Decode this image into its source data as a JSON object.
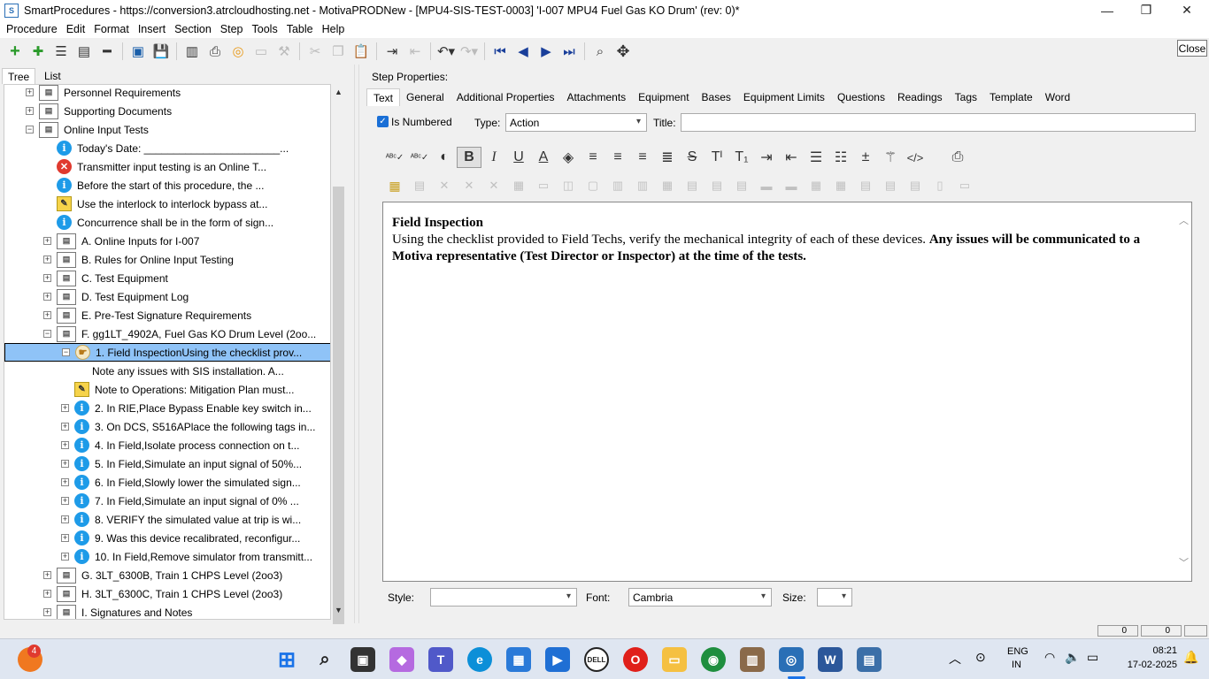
{
  "window": {
    "title": "SmartProcedures - https://conversion3.atrcloudhosting.net - MotivaPRODNew - [MPU4-SIS-TEST-0003] 'I-007 MPU4 Fuel Gas KO Drum' (rev: 0)*",
    "minimize": "—",
    "maximize": "❐",
    "close": "✕"
  },
  "menu": [
    {
      "label": "Procedure"
    },
    {
      "label": "Edit"
    },
    {
      "label": "Format"
    },
    {
      "label": "Insert"
    },
    {
      "label": "Section"
    },
    {
      "label": "Step"
    },
    {
      "label": "Tools"
    },
    {
      "label": "Table"
    },
    {
      "label": "Help"
    }
  ],
  "close_button": "Close",
  "left_tabs": {
    "tree": "Tree",
    "list": "List"
  },
  "tree": [
    {
      "text": "Personnel Requirements",
      "icon": "doc-icon",
      "level": 1,
      "exp": "+"
    },
    {
      "text": "Supporting Documents",
      "icon": "doc-icon",
      "level": 1,
      "exp": "+"
    },
    {
      "text": "Online Input Tests",
      "icon": "doc-icon",
      "level": 1,
      "exp": "−"
    },
    {
      "text": "Today's Date: _______________________...",
      "icon": "info-icon",
      "level": 2,
      "exp": ""
    },
    {
      "text": "Transmitter input testing is an Online T...",
      "icon": "error-icon",
      "level": 2,
      "exp": ""
    },
    {
      "text": "Before the start of this procedure, the ...",
      "icon": "info-icon",
      "level": 2,
      "exp": ""
    },
    {
      "text": "Use the interlock to interlock bypass at...",
      "icon": "note-icon",
      "level": 2,
      "exp": ""
    },
    {
      "text": "Concurrence shall be in the form of sign...",
      "icon": "info-icon",
      "level": 2,
      "exp": ""
    },
    {
      "text": "A. Online Inputs for I-007",
      "icon": "doc-icon",
      "level": 2,
      "exp": "+"
    },
    {
      "text": "B. Rules for Online Input Testing",
      "icon": "doc-icon",
      "level": 2,
      "exp": "+"
    },
    {
      "text": "C. Test Equipment",
      "icon": "doc-icon",
      "level": 2,
      "exp": "+"
    },
    {
      "text": "D. Test Equipment Log",
      "icon": "doc-icon",
      "level": 2,
      "exp": "+"
    },
    {
      "text": "E. Pre-Test Signature Requirements",
      "icon": "doc-icon",
      "level": 2,
      "exp": "+"
    },
    {
      "text": "F. gg1LT_4902A, Fuel Gas KO Drum Level (2oo...",
      "icon": "doc-icon",
      "level": 2,
      "exp": "−"
    },
    {
      "text": "1. Field InspectionUsing the checklist prov...",
      "icon": "step-icon",
      "level": 3,
      "exp": "−",
      "selected": true
    },
    {
      "text": "Note any issues with SIS installation. A...",
      "icon": "none",
      "level": 4,
      "exp": ""
    },
    {
      "text": "Note to Operations: Mitigation Plan must...",
      "icon": "note-icon",
      "level": 3,
      "exp": ""
    },
    {
      "text": "2. In RIE,Place Bypass Enable key switch in...",
      "icon": "info-icon",
      "level": 3,
      "exp": "+"
    },
    {
      "text": "3. On DCS, S516APlace the following tags in...",
      "icon": "info-icon",
      "level": 3,
      "exp": "+"
    },
    {
      "text": "4. In Field,Isolate process connection on t...",
      "icon": "info-icon",
      "level": 3,
      "exp": "+"
    },
    {
      "text": "5. In Field,Simulate an input signal of 50%...",
      "icon": "info-icon",
      "level": 3,
      "exp": "+"
    },
    {
      "text": "6. In Field,Slowly lower the simulated sign...",
      "icon": "info-icon",
      "level": 3,
      "exp": "+"
    },
    {
      "text": "7. In Field,Simulate an input signal of 0% ...",
      "icon": "info-icon",
      "level": 3,
      "exp": "+"
    },
    {
      "text": "8. VERIFY the simulated value at trip is wi...",
      "icon": "info-icon",
      "level": 3,
      "exp": "+"
    },
    {
      "text": "9. Was this device recalibrated, reconfigur...",
      "icon": "info-icon",
      "level": 3,
      "exp": "+"
    },
    {
      "text": "10. In Field,Remove simulator from transmitt...",
      "icon": "info-icon",
      "level": 3,
      "exp": "+"
    },
    {
      "text": "G. 3LT_6300B, Train 1 CHPS Level (2oo3)",
      "icon": "doc-icon",
      "level": 2,
      "exp": "+"
    },
    {
      "text": "H. 3LT_6300C, Train 1 CHPS Level (2oo3)",
      "icon": "doc-icon",
      "level": 2,
      "exp": "+"
    },
    {
      "text": "I. Signatures and Notes",
      "icon": "doc-icon",
      "level": 2,
      "exp": "+"
    }
  ],
  "step_properties": {
    "heading": "Step Properties:",
    "tabs": [
      "Text",
      "General",
      "Additional Properties",
      "Attachments",
      "Equipment",
      "Bases",
      "Equipment Limits",
      "Questions",
      "Readings",
      "Tags",
      "Template",
      "Word"
    ],
    "is_numbered_label": "Is Numbered",
    "type_label": "Type:",
    "type_value": "Action",
    "title_label": "Title:",
    "title_value": ""
  },
  "editor": {
    "heading": "Field Inspection",
    "normal": "Using the checklist provided to Field Techs, verify the mechanical integrity of each of these devices. ",
    "bold": "Any issues will be communicated to a Motiva representative (Test Director or Inspector) at the time of the tests."
  },
  "bottom": {
    "style_label": "Style:",
    "style_value": "",
    "font_label": "Font:",
    "font_value": "Cambria",
    "size_label": "Size:",
    "size_value": ""
  },
  "status": {
    "field1": "0",
    "field2": "0"
  },
  "taskbar": {
    "lang1": "ENG",
    "lang2": "IN",
    "time": "08:21",
    "date": "17-02-2025",
    "badge": "4"
  }
}
